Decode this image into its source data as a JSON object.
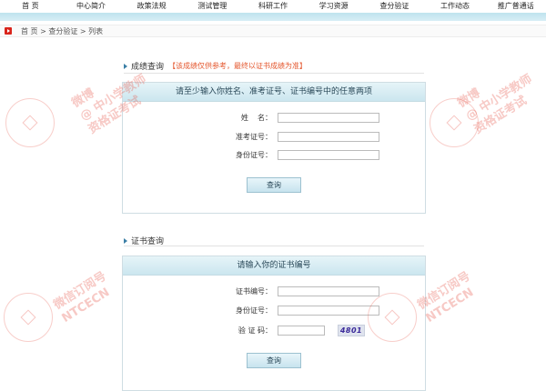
{
  "nav": [
    "首 页",
    "中心简介",
    "政策法规",
    "测试管理",
    "科研工作",
    "学习资源",
    "查分验证",
    "工作动态",
    "推广普通话"
  ],
  "breadcrumb": "首 页 > 查分验证 > 列表",
  "score_query": {
    "title": "成绩查询",
    "note": "【该成绩仅供参考，最终以证书成绩为准】",
    "panel_header": "请至少输入你姓名、准考证号、证书编号中的任意两项",
    "name_label": "姓    名：",
    "name_value": "",
    "exam_no_label": "准考证号：",
    "exam_no_value": "",
    "id_label": "身份证号：",
    "id_value": "",
    "submit_label": "查询"
  },
  "cert_query": {
    "title": "证书查询",
    "panel_header": "请输入你的证书编号",
    "cert_no_label": "证书编号：",
    "cert_no_value": "",
    "id_label": "身份证号：",
    "id_value": "",
    "captcha_label": "验 证 码：",
    "captcha_value": "",
    "captcha_image_text": "4801",
    "submit_label": "查询"
  },
  "watermarks": {
    "weibo_line1": "微博",
    "weibo_line2": "@ 中小学教师",
    "weibo_line3": "资格证考试",
    "wechat_line1": "微信订阅号",
    "wechat_line2": "NTCECN"
  }
}
